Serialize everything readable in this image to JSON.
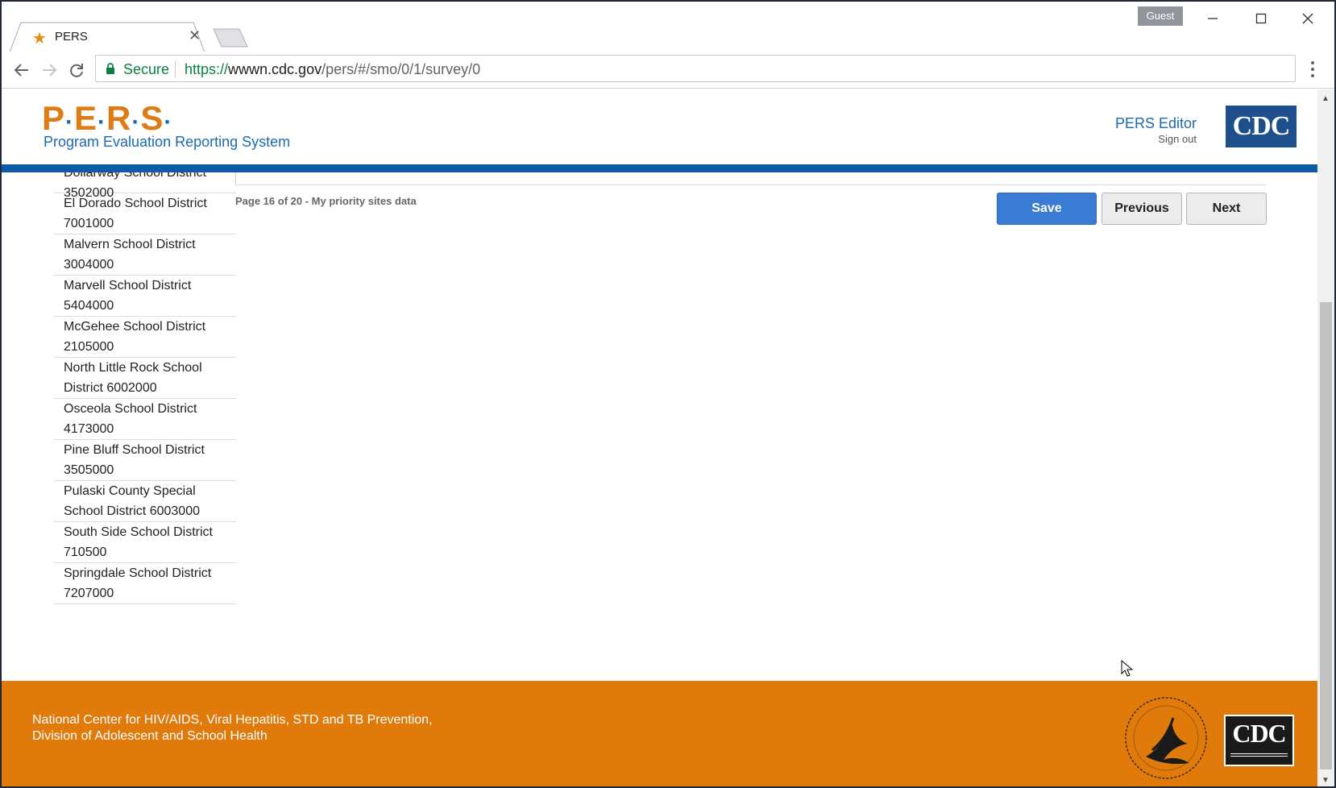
{
  "browser": {
    "tab": {
      "title": "PERS",
      "icon": "star-icon"
    },
    "guest_label": "Guest",
    "secure_label": "Secure",
    "url": {
      "protocol": "https://",
      "host": "wwwn.cdc.gov",
      "path": "/pers/#/smo/0/1/survey/0"
    }
  },
  "header": {
    "logo_letters": [
      "P",
      "E",
      "R",
      "S"
    ],
    "subtitle": "Program Evaluation Reporting System",
    "user_name": "PERS Editor",
    "signout_label": "Sign out",
    "agency_logo": "CDC"
  },
  "main": {
    "page_info": "Page 16 of 20 - My priority sites data",
    "buttons": {
      "save": "Save",
      "previous": "Previous",
      "next": "Next"
    },
    "districts": [
      {
        "line1": "Dollarway School District",
        "line2": "3502000"
      },
      {
        "line1": "El Dorado School District",
        "line2": "7001000"
      },
      {
        "line1": "Malvern School District",
        "line2": "3004000"
      },
      {
        "line1": "Marvell School District",
        "line2": "5404000"
      },
      {
        "line1": "McGehee School District",
        "line2": "2105000"
      },
      {
        "line1": "North Little Rock School",
        "line2": "District 6002000"
      },
      {
        "line1": "Osceola School District",
        "line2": "4173000"
      },
      {
        "line1": "Pine Bluff School District",
        "line2": "3505000"
      },
      {
        "line1": "Pulaski County Special",
        "line2": "School District 6003000"
      },
      {
        "line1": "South Side School District",
        "line2": "710500"
      },
      {
        "line1": "Springdale School District",
        "line2": "7207000"
      }
    ]
  },
  "footer": {
    "line1": "National Center for HIV/AIDS, Viral Hepatitis, STD and TB Prevention,",
    "line2": "Division of Adolescent and School Health",
    "cdc_logo": "CDC"
  },
  "colors": {
    "brand_orange": "#e07b0b",
    "brand_blue": "#0d5ba4",
    "save_blue": "#3a7bd5"
  }
}
